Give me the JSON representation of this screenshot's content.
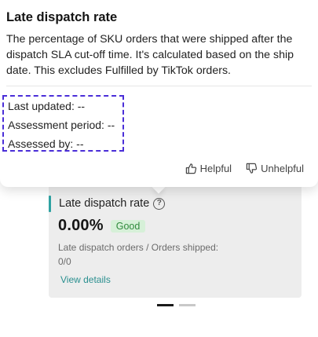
{
  "tooltip": {
    "title": "Late dispatch rate",
    "description": "The percentage of SKU orders that were shipped after the dispatch SLA cut-off time. It's calculated based on the ship date. This excludes Fulfilled by TikTok orders.",
    "last_updated": "Last updated: --",
    "assessment_period": "Assessment period: --",
    "assessed_by": "Assessed by: --",
    "helpful_label": "Helpful",
    "unhelpful_label": "Unhelpful"
  },
  "card": {
    "title": "Late dispatch rate",
    "value": "0.00%",
    "status": "Good",
    "sub_label": "Late dispatch orders / Orders shipped:",
    "sub_value": "0/0",
    "link_label": "View details",
    "accent_color": "#2ea2a2",
    "status_color": "#2f8a3c"
  },
  "pager": {
    "total": 2,
    "active": 1
  }
}
